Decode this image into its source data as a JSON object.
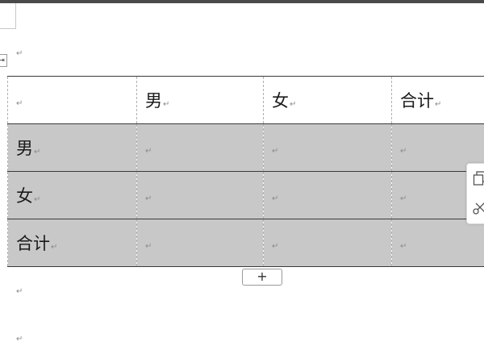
{
  "paragraph_mark": "↵",
  "table": {
    "rows": [
      {
        "cells": [
          "",
          "男",
          "女",
          "合计"
        ]
      },
      {
        "cells": [
          "男",
          "",
          "",
          ""
        ]
      },
      {
        "cells": [
          "女",
          "",
          "",
          ""
        ]
      },
      {
        "cells": [
          "合计",
          "",
          "",
          ""
        ]
      }
    ]
  },
  "add_row_button_label": "+",
  "move_handle_glyph": "⇥",
  "colors": {
    "selection": "#c8c8c8",
    "border": "#3a3a3a",
    "gridline": "#b0b0b0"
  },
  "icons": {
    "table_move_handle": "table-move-icon",
    "copy": "copy-icon",
    "cut": "scissors-icon"
  }
}
